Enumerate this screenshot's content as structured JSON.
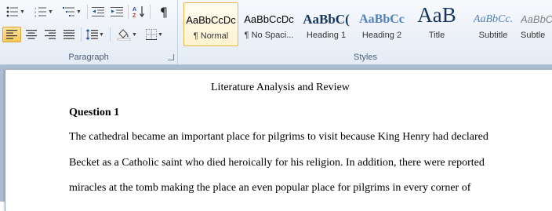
{
  "ribbon": {
    "paragraph_group": {
      "label": "Paragraph",
      "pilcrow": "¶"
    },
    "styles_group": {
      "label": "Styles",
      "items": [
        {
          "sample": "AaBbCcDc",
          "name": "¶ Normal",
          "selected": true
        },
        {
          "sample": "AaBbCcDc",
          "name": "¶ No Spaci..."
        },
        {
          "sample": "AaBbC(",
          "name": "Heading 1"
        },
        {
          "sample": "AaBbCc",
          "name": "Heading 2"
        },
        {
          "sample": "AaB",
          "name": "Title"
        },
        {
          "sample": "AaBbCc.",
          "name": "Subtitle"
        },
        {
          "sample": "AaBbCcDc",
          "name": "Subtle"
        }
      ]
    }
  },
  "document": {
    "title": "Literature Analysis and Review",
    "heading": "Question 1",
    "lines": [
      "The cathedral became an important place for pilgrims to visit because King Henry had declared",
      "Becket as a Catholic saint who died heroically for his religion. In addition, there were reported",
      "miracles at the tomb making the place an even popular place for pilgrims in every corner of"
    ]
  },
  "colors": {
    "accent_highlight": "#f8c75a",
    "heading_blue": "#17365d",
    "heading2_blue": "#4f81bd",
    "workspace": "#abbbd0"
  }
}
